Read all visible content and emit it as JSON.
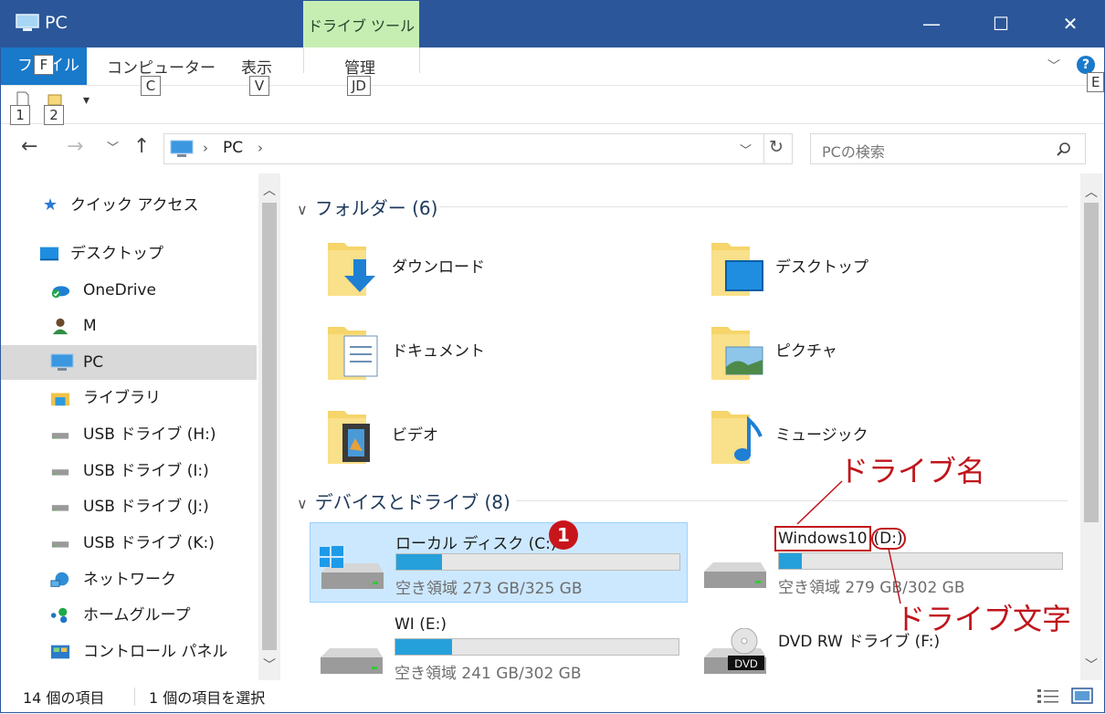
{
  "window": {
    "title": "PC",
    "minimize": "—",
    "maximize": "☐",
    "close": "✕"
  },
  "ribbon": {
    "context_group": "ドライブ ツール",
    "file_tab": "ファイル",
    "file_keytip": "F",
    "tabs": [
      {
        "label": "コンピューター",
        "keytip": "C"
      },
      {
        "label": "表示",
        "keytip": "V"
      },
      {
        "label": "管理",
        "keytip": "JD"
      }
    ],
    "help_keytip": "E",
    "qat_keytips": [
      "1",
      "2"
    ]
  },
  "address": {
    "crumbs": [
      "PC"
    ],
    "search_placeholder": "PCの検索"
  },
  "nav": {
    "items": [
      {
        "label": "クイック アクセス",
        "icon": "star-icon"
      },
      {
        "label": "デスクトップ",
        "icon": "desktop-icon"
      },
      {
        "label": "OneDrive",
        "icon": "onedrive-icon"
      },
      {
        "label": "M",
        "icon": "user-icon"
      },
      {
        "label": "PC",
        "icon": "pc-icon",
        "selected": true
      },
      {
        "label": "ライブラリ",
        "icon": "library-icon"
      },
      {
        "label": "USB ドライブ (H:)",
        "icon": "usb-drive-icon"
      },
      {
        "label": "USB ドライブ (I:)",
        "icon": "usb-drive-icon"
      },
      {
        "label": "USB ドライブ (J:)",
        "icon": "usb-drive-icon"
      },
      {
        "label": "USB ドライブ (K:)",
        "icon": "usb-drive-icon"
      },
      {
        "label": "ネットワーク",
        "icon": "network-icon"
      },
      {
        "label": "ホームグループ",
        "icon": "homegroup-icon"
      },
      {
        "label": "コントロール パネル",
        "icon": "control-panel-icon"
      }
    ]
  },
  "content": {
    "folders_header": "フォルダー (6)",
    "folders": [
      {
        "label": "ダウンロード",
        "icon": "downloads-folder-icon"
      },
      {
        "label": "デスクトップ",
        "icon": "desktop-folder-icon"
      },
      {
        "label": "ドキュメント",
        "icon": "documents-folder-icon"
      },
      {
        "label": "ピクチャ",
        "icon": "pictures-folder-icon"
      },
      {
        "label": "ビデオ",
        "icon": "videos-folder-icon"
      },
      {
        "label": "ミュージック",
        "icon": "music-folder-icon"
      }
    ],
    "drives_header": "デバイスとドライブ (8)",
    "drives": [
      {
        "name": "ローカル ディスク (C:)",
        "free": "空き領域 273 GB/325 GB",
        "used_fraction": 0.16,
        "icon": "windows-drive-icon",
        "selected": true
      },
      {
        "name_part": "Windows10",
        "letter_part": "(D:)",
        "free": "空き領域 279 GB/302 GB",
        "used_fraction": 0.08,
        "icon": "hard-drive-icon"
      },
      {
        "name": "WI (E:)",
        "free": "空き領域 241 GB/302 GB",
        "used_fraction": 0.2,
        "icon": "hard-drive-icon"
      },
      {
        "name": "DVD RW ドライブ (F:)",
        "icon": "dvd-drive-icon",
        "dvd_label": "DVD"
      }
    ]
  },
  "annotations": {
    "badge": "1",
    "drive_name": "ドライブ名",
    "drive_letter": "ドライブ文字"
  },
  "status": {
    "count": "14 個の項目",
    "selected": "1 個の項目を選択"
  },
  "colors": {
    "accent": "#2b579a",
    "context_tab": "#c6eeb3",
    "file_tab": "#1979ca",
    "bar_fill": "#26a0da",
    "annotation": "#c0151b"
  }
}
